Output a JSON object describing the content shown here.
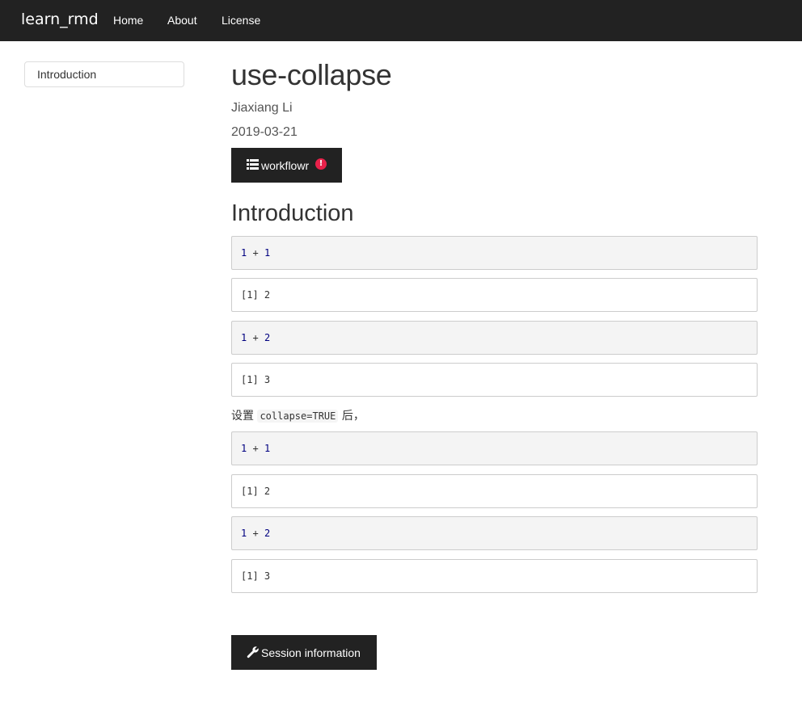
{
  "nav": {
    "brand": "learn_rmd",
    "links": [
      "Home",
      "About",
      "License"
    ]
  },
  "toc": {
    "items": [
      "Introduction"
    ]
  },
  "header": {
    "title": "use-collapse",
    "author": "Jiaxiang Li",
    "date": "2019-03-21"
  },
  "workflowr_button": {
    "icon": "list-icon",
    "label": "workflowr",
    "badge_icon": "exclamation-circle-icon",
    "badge_color": "#e8214a"
  },
  "section": {
    "heading": "Introduction"
  },
  "blocks_before": [
    {
      "kind": "source",
      "a": "1",
      "op": "+",
      "b": "1"
    },
    {
      "kind": "output",
      "text": "[1] 2"
    },
    {
      "kind": "source",
      "a": "1",
      "op": "+",
      "b": "2"
    },
    {
      "kind": "output",
      "text": "[1] 3"
    }
  ],
  "paragraph": {
    "prefix": "设置",
    "code": "collapse=TRUE",
    "suffix": "后，"
  },
  "blocks_after": [
    {
      "kind": "source",
      "a": "1",
      "op": "+",
      "b": "1"
    },
    {
      "kind": "output",
      "text": "[1] 2"
    },
    {
      "kind": "source",
      "a": "1",
      "op": "+",
      "b": "2"
    },
    {
      "kind": "output",
      "text": "[1] 3"
    }
  ],
  "session_button": {
    "icon": "wrench-icon",
    "label": "Session information"
  },
  "colors": {
    "navbar": "#222222",
    "code_number": "#000080",
    "source_background": "#f4f4f4"
  }
}
